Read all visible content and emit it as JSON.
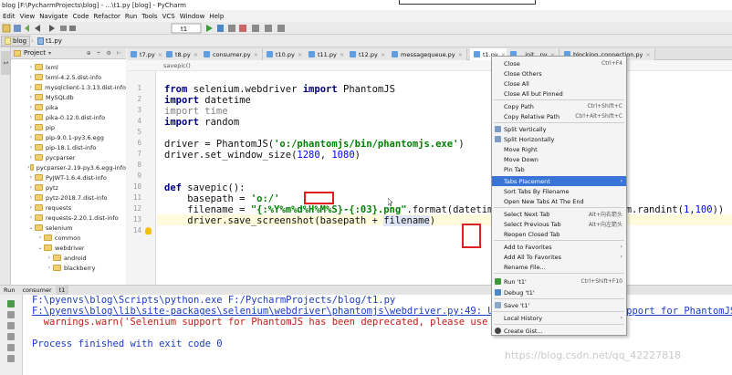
{
  "window": {
    "title": "blog [F:\\PycharmProjects\\blog] - ...\\t1.py [blog] - PyCharm"
  },
  "menu": [
    "Edit",
    "View",
    "Navigate",
    "Code",
    "Refactor",
    "Run",
    "Tools",
    "VCS",
    "Window",
    "Help"
  ],
  "breadcrumbs": [
    "blog",
    "t1.py"
  ],
  "toolbar": {
    "run_config": "t1"
  },
  "project_panel": {
    "title": "Project"
  },
  "tree_items": [
    {
      "label": "lxml",
      "expanded": false
    },
    {
      "label": "lxml-4.2.5.dist-info",
      "expanded": false
    },
    {
      "label": "mysqlclient-1.3.13.dist-info",
      "expanded": false
    },
    {
      "label": "MySQLdb",
      "expanded": false
    },
    {
      "label": "pika",
      "expanded": false
    },
    {
      "label": "pika-0.12.0.dist-info",
      "expanded": false
    },
    {
      "label": "pip",
      "expanded": false
    },
    {
      "label": "pip-9.0.1-py3.6.egg",
      "expanded": false
    },
    {
      "label": "pip-18.1.dist-info",
      "expanded": false
    },
    {
      "label": "pycparser",
      "expanded": false
    },
    {
      "label": "pycparser-2.19-py3.6.egg-info",
      "expanded": false
    },
    {
      "label": "PyJWT-1.6.4.dist-info",
      "expanded": false
    },
    {
      "label": "pytz",
      "expanded": false
    },
    {
      "label": "pytz-2018.7.dist-info",
      "expanded": false
    },
    {
      "label": "requests",
      "expanded": false
    },
    {
      "label": "requests-2.20.1.dist-info",
      "expanded": false
    },
    {
      "label": "selenium",
      "expanded": true
    },
    {
      "label": "common",
      "expanded": false
    },
    {
      "label": "webdriver",
      "expanded": true
    },
    {
      "label": "android",
      "expanded": false
    },
    {
      "label": "blackberry",
      "expanded": false
    }
  ],
  "tabs": [
    "t7.py",
    "t8.py",
    "consumer.py",
    "t10.py",
    "t11.py",
    "t12.py",
    "messagequeue.py",
    "t1.py",
    "...init...py",
    "blocking_connection.py"
  ],
  "editor": {
    "crumb": "savepic()",
    "line_numbers": [
      "1",
      "2",
      "3",
      "4",
      "5",
      "6",
      "7",
      "8",
      "9",
      "10",
      "11",
      "12",
      "13",
      "14"
    ],
    "code": [
      "",
      "from selenium.webdriver import PhantomJS",
      "import datetime",
      "import time",
      "import random",
      "",
      "driver = PhantomJS('o:/phantomjs/bin/phantomjs.exe')",
      "driver.set_window_size(1280, 1080)",
      "",
      "",
      "def savepic():",
      "    basepath = 'o:/'",
      "    filename = \"{:%Y%m%d%H%M%S}-{:03}.png\".format(datetime.datetime.now(), random.randint(1,100))",
      "    driver.save_screenshot(basepath + filename)"
    ]
  },
  "bottom_tabs": [
    "Run",
    "consumer",
    "t1"
  ],
  "console": [
    "F:\\pyenvs\\blog\\Scripts\\python.exe F:/PycharmProjects/blog/t1.py",
    "F:\\pyenvs\\blog\\lib\\site-packages\\selenium\\webdriver\\phantomjs\\webdriver.py:49: UserWarning: Selenium support for PhantomJS",
    "  warnings.warn('Selenium support for PhantomJS has been deprecated, please use headless",
    "",
    "Process finished with exit code 0"
  ],
  "context_menu": [
    {
      "label": "Close",
      "shortcut": "Ctrl+F4"
    },
    {
      "label": "Close Others",
      "shortcut": ""
    },
    {
      "label": "Close All",
      "shortcut": ""
    },
    {
      "label": "Close All but Pinned",
      "shortcut": ""
    },
    {
      "label": "Split Vertically",
      "shortcut": ""
    },
    {
      "label": "Split Horizontally",
      "shortcut": ""
    },
    {
      "label": "Move Right",
      "shortcut": ""
    },
    {
      "label": "Move Down",
      "shortcut": ""
    },
    {
      "label": "Pin Tab",
      "shortcut": ""
    },
    {
      "label": "Tabs Placement",
      "shortcut": "›"
    },
    {
      "label": "Sort Tabs By Filename",
      "shortcut": ""
    },
    {
      "label": "Open New Tabs At The End",
      "shortcut": ""
    },
    {
      "label": "Select Next Tab",
      "shortcut": "Alt+向右箭头"
    },
    {
      "label": "Select Previous Tab",
      "shortcut": "Alt+向左箭头"
    },
    {
      "label": "Reopen Closed Tab",
      "shortcut": ""
    },
    {
      "label": "Add to Favorites",
      "shortcut": "›"
    },
    {
      "label": "Add All To Favorites",
      "shortcut": "›"
    },
    {
      "label": "Rename File...",
      "shortcut": ""
    },
    {
      "label": "Run 't1'",
      "shortcut": "Ctrl+Shift+F10"
    },
    {
      "label": "Debug 't1'",
      "shortcut": ""
    },
    {
      "label": "Save 't1'",
      "shortcut": ""
    },
    {
      "label": "Local History",
      "shortcut": "›"
    },
    {
      "label": "Create Gist...",
      "shortcut": ""
    }
  ],
  "context_menu_copy": [
    {
      "label": "Copy Path",
      "shortcut": "Ctrl+Shift+C"
    },
    {
      "label": "Copy Relative Path",
      "shortcut": "Ctrl+Alt+Shift+C"
    }
  ],
  "watermark": "https://blog.csdn.net/qq_42227818"
}
